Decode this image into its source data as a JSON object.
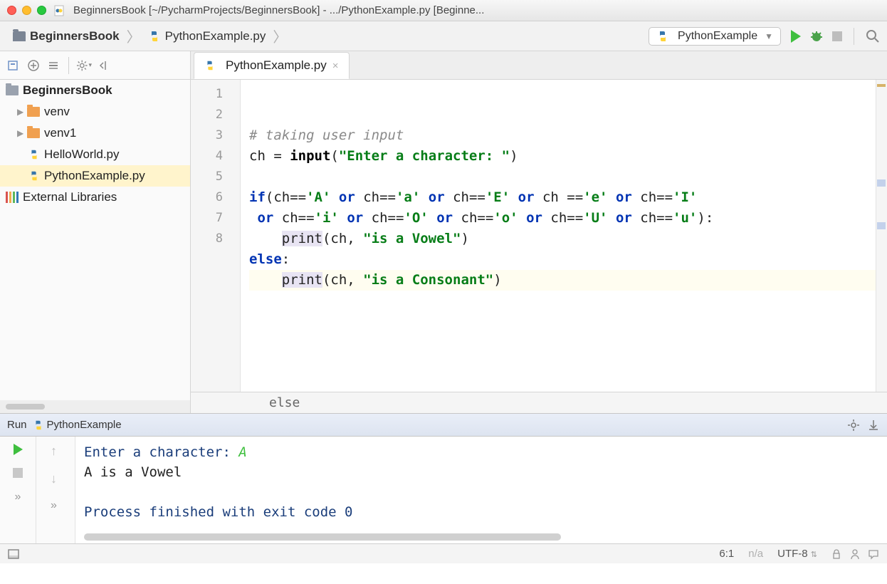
{
  "window": {
    "title": "BeginnersBook [~/PycharmProjects/BeginnersBook] - .../PythonExample.py [Beginne..."
  },
  "breadcrumb": {
    "project": "BeginnersBook",
    "file": "PythonExample.py"
  },
  "runconfig": {
    "name": "PythonExample"
  },
  "sidebar": {
    "project": "BeginnersBook",
    "items": [
      "venv",
      "venv1",
      "HelloWorld.py",
      "PythonExample.py"
    ],
    "external": "External Libraries"
  },
  "tab": {
    "name": "PythonExample.py"
  },
  "code": {
    "lines": [
      {
        "n": "1",
        "t": "comment",
        "raw": "# taking user input"
      },
      {
        "n": "2",
        "t": "assign",
        "v": "ch",
        "fn": "input",
        "s": "\"Enter a character: \""
      },
      {
        "n": "3",
        "t": "blank"
      },
      {
        "n": "4",
        "t": "raw",
        "html": "<span class='c-kw'>if</span>(ch==<span class='c-str'>'A'</span> <span class='c-kw'>or</span> ch==<span class='c-str'>'a'</span> <span class='c-kw'>or</span> ch==<span class='c-str'>'E'</span> <span class='c-kw'>or</span> ch ==<span class='c-str'>'e'</span> <span class='c-kw'>or</span> ch==<span class='c-str'>'I'</span>"
      },
      {
        "n": "5",
        "t": "raw",
        "html": " <span class='c-kw'>or</span> ch==<span class='c-str'>'i'</span> <span class='c-kw'>or</span> ch==<span class='c-str'>'O'</span> <span class='c-kw'>or</span> ch==<span class='c-str'>'o'</span> <span class='c-kw'>or</span> ch==<span class='c-str'>'U'</span> <span class='c-kw'>or</span> ch==<span class='c-str'>'u'</span>):"
      },
      {
        "n": "6",
        "t": "raw",
        "html": "    <span class='c-print'>print</span>(ch, <span class='c-str'>\"is a Vowel\"</span>)"
      },
      {
        "n": "7",
        "t": "raw",
        "html": "<span class='c-kw'>else</span>:"
      },
      {
        "n": "8",
        "t": "raw",
        "cur": true,
        "html": "    <span class='c-print'>print</span>(ch, <span class='c-str'>\"is a Consonant\"</span>)"
      }
    ],
    "crumb": "else"
  },
  "run": {
    "label": "Run",
    "config": "PythonExample",
    "lines": [
      {
        "html": "<span class='navy'>Enter a character: </span><span class='userin'>A</span>"
      },
      {
        "html": "A is a Vowel"
      },
      {
        "html": "&nbsp;"
      },
      {
        "html": "<span class='navy'>Process finished with exit code 0</span>"
      }
    ]
  },
  "status": {
    "pos": "6:1",
    "na": "n/a",
    "enc": "UTF-8"
  }
}
